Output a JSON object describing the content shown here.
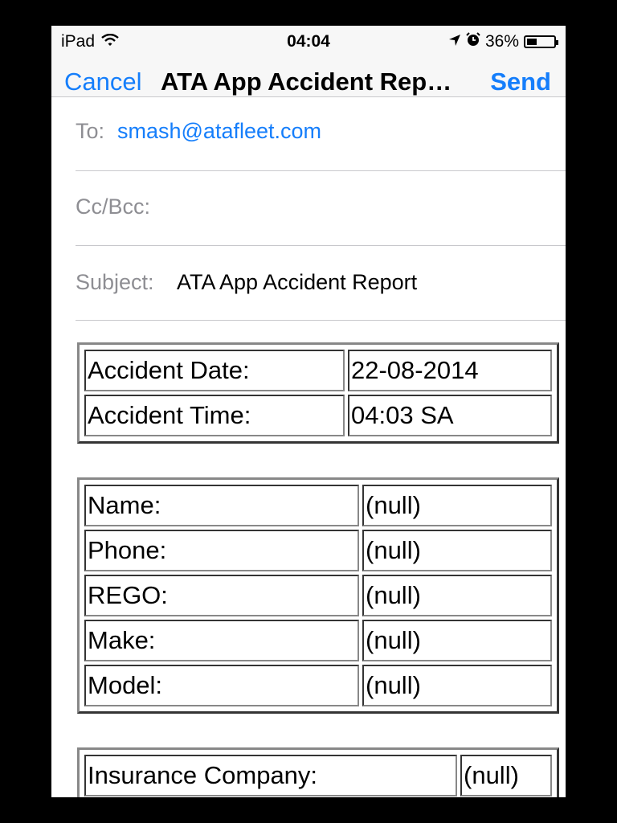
{
  "status_bar": {
    "device": "iPad",
    "time": "04:04",
    "battery_percent": "36%",
    "battery_level": 0.36
  },
  "nav": {
    "cancel_label": "Cancel",
    "title": "ATA App Accident Rep…",
    "send_label": "Send"
  },
  "fields": {
    "to_label": "To:",
    "to_value": "smash@atafleet.com",
    "cc_label": "Cc/Bcc:",
    "subject_label": "Subject:",
    "subject_value": "ATA App Accident Report"
  },
  "tables": {
    "accident": [
      {
        "label": "Accident Date:",
        "value": "22-08-2014"
      },
      {
        "label": "Accident Time:",
        "value": "04:03 SA"
      }
    ],
    "driver": [
      {
        "label": "Name:",
        "value": "(null)"
      },
      {
        "label": "Phone:",
        "value": "(null)"
      },
      {
        "label": "REGO:",
        "value": "(null)"
      },
      {
        "label": "Make:",
        "value": "(null)"
      },
      {
        "label": "Model:",
        "value": "(null)"
      }
    ],
    "insurance": [
      {
        "label": "Insurance Company:",
        "value": "(null)"
      }
    ]
  },
  "colors": {
    "accent": "#157efb",
    "label_gray": "#8e8e93",
    "bar_bg": "#f7f7f7"
  }
}
